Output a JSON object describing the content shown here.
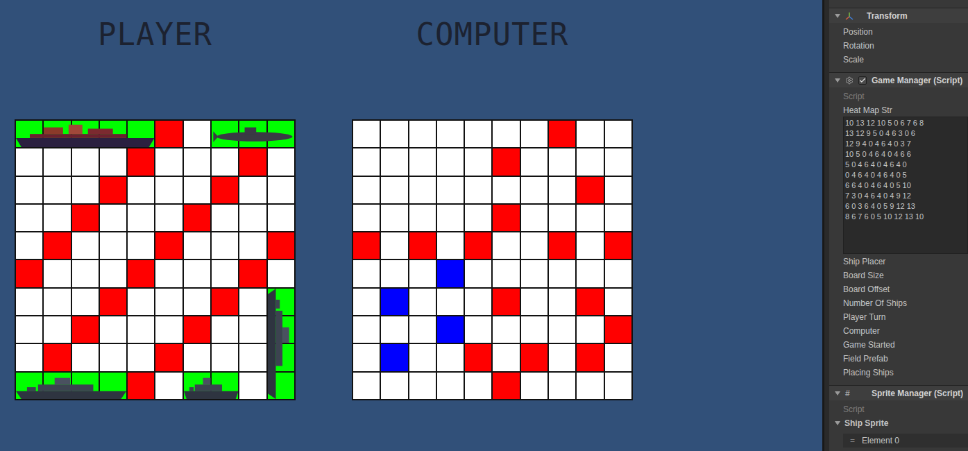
{
  "boards": [
    {
      "title": "PLAYER",
      "rows": [
        [
          "ship",
          "ship",
          "ship",
          "ship",
          "ship",
          "shot",
          "empty",
          "ship",
          "ship",
          "ship"
        ],
        [
          "empty",
          "empty",
          "empty",
          "empty",
          "shot",
          "empty",
          "empty",
          "empty",
          "shot",
          "empty"
        ],
        [
          "empty",
          "empty",
          "empty",
          "shot",
          "empty",
          "empty",
          "empty",
          "shot",
          "empty",
          "empty"
        ],
        [
          "empty",
          "empty",
          "shot",
          "empty",
          "empty",
          "empty",
          "shot",
          "empty",
          "empty",
          "empty"
        ],
        [
          "empty",
          "shot",
          "empty",
          "empty",
          "empty",
          "shot",
          "empty",
          "empty",
          "empty",
          "shot"
        ],
        [
          "shot",
          "empty",
          "empty",
          "empty",
          "shot",
          "empty",
          "empty",
          "empty",
          "shot",
          "empty"
        ],
        [
          "empty",
          "empty",
          "empty",
          "shot",
          "empty",
          "empty",
          "empty",
          "shot",
          "empty",
          "ship"
        ],
        [
          "empty",
          "empty",
          "shot",
          "empty",
          "empty",
          "empty",
          "shot",
          "empty",
          "empty",
          "ship"
        ],
        [
          "empty",
          "shot",
          "empty",
          "empty",
          "empty",
          "shot",
          "empty",
          "empty",
          "empty",
          "ship"
        ],
        [
          "ship",
          "ship",
          "ship",
          "ship",
          "shot",
          "empty",
          "ship",
          "ship",
          "empty",
          "ship"
        ]
      ],
      "ships": [
        {
          "kind": "carrier",
          "row": 0,
          "col": 0,
          "length": 5,
          "vertical": false
        },
        {
          "kind": "submarine",
          "row": 0,
          "col": 7,
          "length": 3,
          "vertical": false
        },
        {
          "kind": "battleship",
          "row": 9,
          "col": 0,
          "length": 4,
          "vertical": false
        },
        {
          "kind": "destroyer",
          "row": 9,
          "col": 6,
          "length": 2,
          "vertical": false
        },
        {
          "kind": "cruiser",
          "row": 6,
          "col": 9,
          "length": 4,
          "vertical": true
        }
      ]
    },
    {
      "title": "COMPUTER",
      "rows": [
        [
          "empty",
          "empty",
          "empty",
          "empty",
          "empty",
          "empty",
          "empty",
          "shot",
          "empty",
          "empty"
        ],
        [
          "empty",
          "empty",
          "empty",
          "empty",
          "empty",
          "shot",
          "empty",
          "empty",
          "empty",
          "empty"
        ],
        [
          "empty",
          "empty",
          "empty",
          "empty",
          "empty",
          "empty",
          "empty",
          "empty",
          "shot",
          "empty"
        ],
        [
          "empty",
          "empty",
          "empty",
          "empty",
          "empty",
          "shot",
          "empty",
          "empty",
          "empty",
          "empty"
        ],
        [
          "shot",
          "empty",
          "shot",
          "empty",
          "shot",
          "empty",
          "empty",
          "shot",
          "empty",
          "shot"
        ],
        [
          "empty",
          "empty",
          "empty",
          "target",
          "empty",
          "empty",
          "empty",
          "empty",
          "empty",
          "empty"
        ],
        [
          "empty",
          "target",
          "empty",
          "empty",
          "empty",
          "shot",
          "empty",
          "empty",
          "shot",
          "empty"
        ],
        [
          "empty",
          "empty",
          "empty",
          "target",
          "empty",
          "empty",
          "empty",
          "empty",
          "empty",
          "shot"
        ],
        [
          "empty",
          "target",
          "empty",
          "empty",
          "shot",
          "empty",
          "shot",
          "empty",
          "shot",
          "empty"
        ],
        [
          "empty",
          "empty",
          "empty",
          "empty",
          "empty",
          "shot",
          "empty",
          "empty",
          "empty",
          "empty"
        ]
      ],
      "ships": []
    }
  ],
  "inspector": {
    "transform": {
      "title": "Transform",
      "expanded": true,
      "fields": [
        "Position",
        "Rotation",
        "Scale"
      ]
    },
    "game_manager": {
      "title": "Game Manager (Script)",
      "expanded": true,
      "enabled": true,
      "script_label": "Script",
      "heat_map": {
        "label": "Heat Map Str",
        "lines": [
          "10 13 12 10 5 0 6 7 6 8",
          "13 12 9 5 0 4 6 3 0 6",
          "12 9 4 0 4 6 4 0 3 7",
          "10 5 0 4 6 4 0 4 6 6",
          "5 0 4 6 4 0 4 6 4 0",
          "0 4 6 4 0 4 6 4 0 5",
          "6 6 4 0 4 6 4 0 5 10",
          "7 3 0 4 6 4 0 4 9 12",
          "6 0 3 6 4 0 5 9 12 13",
          "8 6 7 6 0 5 10 12 13 10"
        ]
      },
      "fields": [
        "Ship Placer",
        "Board Size",
        "Board Offset",
        "Number Of Ships",
        "Player Turn",
        "Computer",
        "Game Started",
        "Field Prefab",
        "Placing Ships"
      ]
    },
    "sprite_manager": {
      "title": "Sprite Manager (Script)",
      "icon": "#",
      "expanded": true,
      "script_label": "Script",
      "list": {
        "label": "Ship Sprite",
        "expanded": true,
        "handle": "=",
        "items": [
          "Element 0"
        ]
      }
    }
  }
}
